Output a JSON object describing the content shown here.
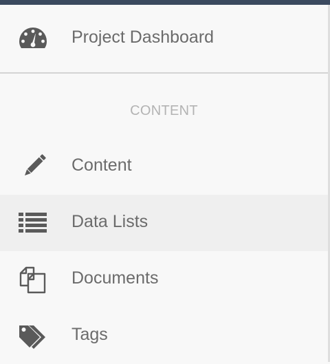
{
  "sidebar": {
    "dashboard": {
      "label": "Project Dashboard",
      "icon": "dashboard-gauge-icon"
    },
    "section_header": "CONTENT",
    "items": [
      {
        "label": "Content",
        "icon": "pencil-icon",
        "active": false
      },
      {
        "label": "Data Lists",
        "icon": "list-icon",
        "active": true
      },
      {
        "label": "Documents",
        "icon": "documents-icon",
        "active": false
      },
      {
        "label": "Tags",
        "icon": "tags-icon",
        "active": false
      }
    ]
  },
  "colors": {
    "top_bar": "#3b4a5f",
    "background": "#f8f8f8",
    "active_item": "#efefef",
    "text": "#6b6b6b",
    "section_header": "#b3b3b3",
    "icon": "#5a5a5a"
  }
}
